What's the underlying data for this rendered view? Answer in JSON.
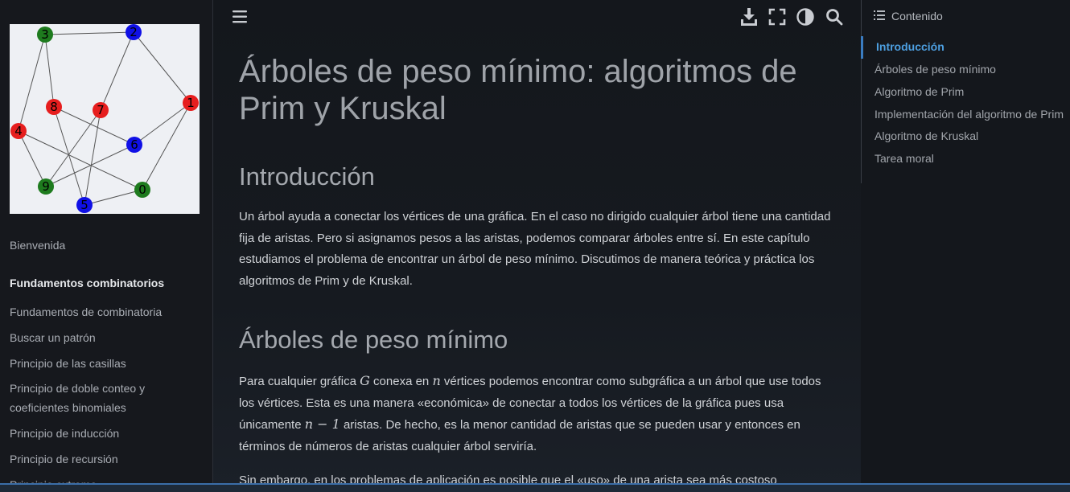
{
  "logo": {
    "nodes": [
      {
        "label": "3",
        "color": "#1e7b1e"
      },
      {
        "label": "2",
        "color": "#1010e6"
      },
      {
        "label": "8",
        "color": "#e61e1e"
      },
      {
        "label": "7",
        "color": "#e61e1e"
      },
      {
        "label": "1",
        "color": "#e61e1e"
      },
      {
        "label": "4",
        "color": "#e61e1e"
      },
      {
        "label": "6",
        "color": "#1010e6"
      },
      {
        "label": "9",
        "color": "#1e7b1e"
      },
      {
        "label": "0",
        "color": "#1e7b1e"
      },
      {
        "label": "5",
        "color": "#1010e6"
      }
    ]
  },
  "sidebar": {
    "items": [
      {
        "label": "Bienvenida",
        "header": false
      },
      {
        "label": "Fundamentos combinatorios",
        "header": true
      },
      {
        "label": "Fundamentos de combinatoria",
        "header": false
      },
      {
        "label": "Buscar un patrón",
        "header": false
      },
      {
        "label": "Principio de las casillas",
        "header": false
      },
      {
        "label": "Principio de doble conteo y coeficientes binomiales",
        "header": false
      },
      {
        "label": "Principio de inducción",
        "header": false
      },
      {
        "label": "Principio de recursión",
        "header": false
      },
      {
        "label": "Principio extremo",
        "header": false
      }
    ]
  },
  "topbar": {
    "icons": [
      "menu-icon",
      "download-icon",
      "fullscreen-icon",
      "theme-toggle-icon",
      "search-icon"
    ]
  },
  "main": {
    "title": "Árboles de peso mínimo: algoritmos de Prim y Kruskal",
    "section1": {
      "heading": "Introducción",
      "text": "Un árbol ayuda a conectar los vértices de una gráfica. En el caso no dirigido cualquier árbol tiene una cantidad fija de aristas. Pero si asignamos pesos a las aristas, podemos comparar árboles entre sí. En este capítulo estudiamos el problema de encontrar un árbol de peso mínimo. Discutimos de manera teórica y práctica los algoritmos de Prim y de Kruskal."
    },
    "section2": {
      "heading": "Árboles de peso mínimo",
      "p1": {
        "t1": "Para cualquier gráfica ",
        "m1": "G",
        "t2": " conexa en ",
        "m2": "n",
        "t3": " vértices podemos encontrar como subgráfica a un árbol que use todos los vértices. Esta es una manera «económica» de conectar a todos los vértices de la gráfica pues usa únicamente ",
        "m3": "n − 1",
        "t4": " aristas. De hecho, es la menor cantidad de aristas que se pueden usar y entonces en términos de números de aristas cualquier árbol serviría."
      },
      "p2": "Sin embargo, en los problemas de aplicación es posible que el «uso» de una arista sea más costoso"
    }
  },
  "toc": {
    "title": "Contenido",
    "items": [
      {
        "label": "Introducción",
        "active": true
      },
      {
        "label": "Árboles de peso mínimo",
        "active": false
      },
      {
        "label": "Algoritmo de Prim",
        "active": false
      },
      {
        "label": "Implementación del algoritmo de Prim",
        "active": false
      },
      {
        "label": "Algoritmo de Kruskal",
        "active": false
      },
      {
        "label": "Tarea moral",
        "active": false
      }
    ]
  },
  "colors": {
    "accent": "#4d9fe0",
    "background": "#13161b"
  }
}
